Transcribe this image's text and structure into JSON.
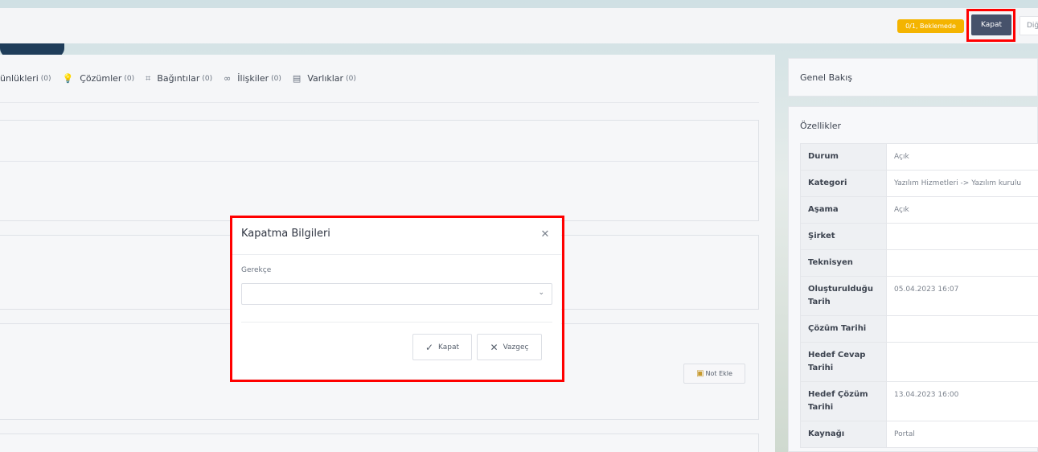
{
  "topbar": {
    "status_badge": "0/1, Beklemede",
    "close_button": "Kapat",
    "other_button": "Diğ"
  },
  "tabs": [
    {
      "label": "ünlükleri",
      "count": "(0)",
      "icon": "log-icon"
    },
    {
      "label": "Çözümler",
      "count": "(0)",
      "icon": "lightbulb-icon"
    },
    {
      "label": "Bağıntılar",
      "count": "(0)",
      "icon": "relation-icon"
    },
    {
      "label": "İlişkiler",
      "count": "(0)",
      "icon": "link-icon"
    },
    {
      "label": "Varlıklar",
      "count": "(0)",
      "icon": "asset-icon"
    }
  ],
  "notes": {
    "add_note_button": "Not Ekle"
  },
  "side": {
    "overview_title": "Genel Bakış",
    "properties_title": "Özellikler",
    "properties": [
      {
        "key": "Durum",
        "value": "Açık"
      },
      {
        "key": "Kategori",
        "value": "Yazılım Hizmetleri -> Yazılım kurulu"
      },
      {
        "key": "Aşama",
        "value": "Açık"
      },
      {
        "key": "Şirket",
        "value": ""
      },
      {
        "key": "Teknisyen",
        "value": ""
      },
      {
        "key": "Oluşturulduğu Tarih",
        "value": "05.04.2023 16:07"
      },
      {
        "key": "Çözüm Tarihi",
        "value": ""
      },
      {
        "key": "Hedef Cevap Tarihi",
        "value": ""
      },
      {
        "key": "Hedef Çözüm Tarihi",
        "value": "13.04.2023 16:00"
      },
      {
        "key": "Kaynağı",
        "value": "Portal"
      }
    ]
  },
  "modal": {
    "title": "Kapatma Bilgileri",
    "field_label": "Gerekçe",
    "select_value": "",
    "confirm_button": "Kapat",
    "cancel_button": "Vazgeç"
  },
  "colors": {
    "accent": "#46526b",
    "pending": "#f4b400",
    "highlight": "#ff0000"
  }
}
